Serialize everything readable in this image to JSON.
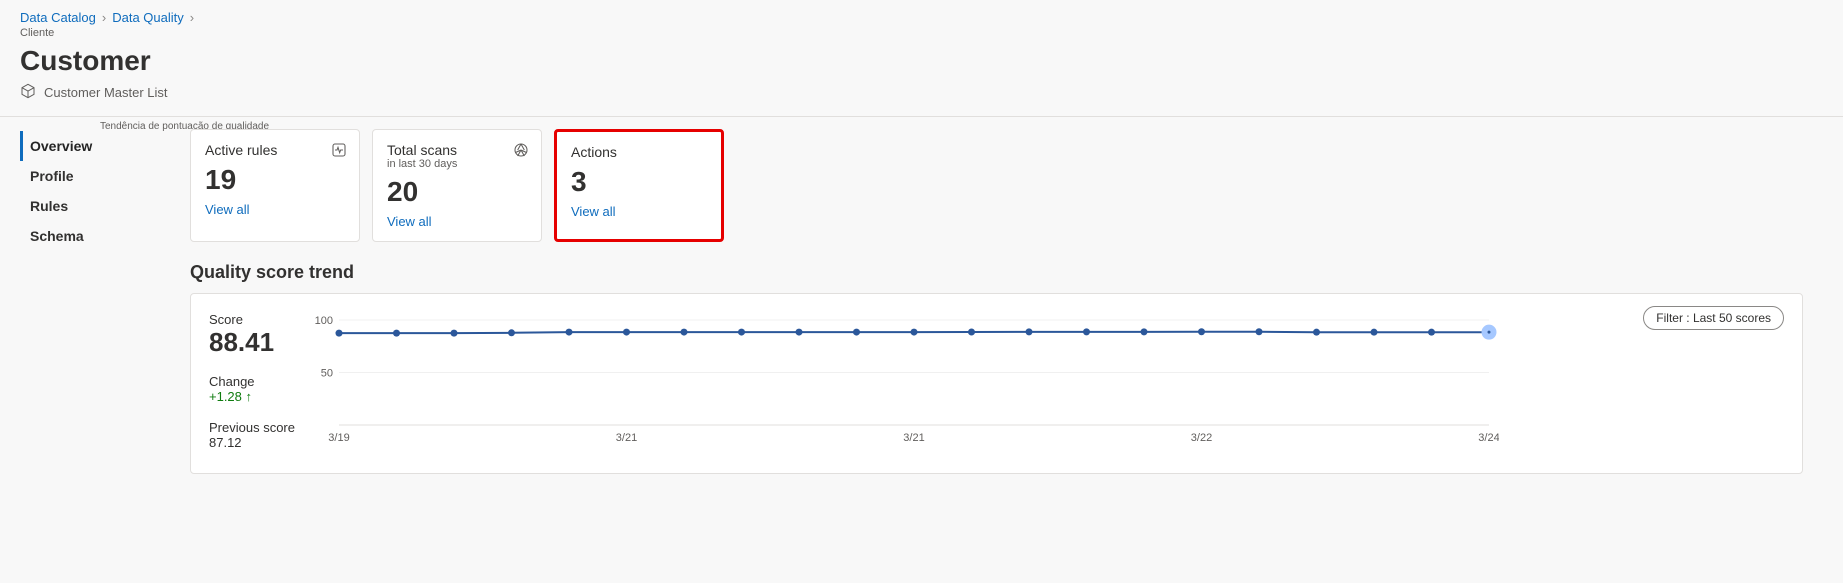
{
  "breadcrumbs": {
    "items": [
      "Data Catalog",
      "Data Quality"
    ],
    "sub": "Cliente"
  },
  "page_title": "Customer",
  "subtitle": "Customer Master List",
  "annotation": "Tendência de pontuação de qualidade",
  "sidebar": {
    "items": [
      {
        "label": "Overview",
        "selected": true
      },
      {
        "label": "Profile",
        "selected": false
      },
      {
        "label": "Rules",
        "selected": false
      },
      {
        "label": "Schema",
        "selected": false
      }
    ]
  },
  "cards": [
    {
      "title": "Active rules",
      "sub": "",
      "value": "19",
      "link": "View all",
      "icon": "heartbeat-icon",
      "highlight": false
    },
    {
      "title": "Total scans",
      "sub": "in last 30 days",
      "value": "20",
      "link": "View all",
      "icon": "aperture-icon",
      "highlight": false
    },
    {
      "title": "Actions",
      "sub": "",
      "value": "3",
      "link": "View all",
      "icon": "",
      "highlight": true
    }
  ],
  "section_title": "Quality score trend",
  "filter_label": "Filter : Last 50 scores",
  "score_panel": {
    "score_label": "Score",
    "score": "88.41",
    "change_label": "Change",
    "change": "+1.28 ↑",
    "prev_label": "Previous score",
    "prev": "87.12"
  },
  "chart_data": {
    "type": "line",
    "ylim": [
      0,
      100
    ],
    "yticks": [
      100,
      50
    ],
    "xticks": [
      "3/19",
      "3/21",
      "3/21",
      "3/22",
      "3/24"
    ],
    "values": [
      87.5,
      87.5,
      87.5,
      87.8,
      88.5,
      88.5,
      88.5,
      88.5,
      88.5,
      88.5,
      88.5,
      88.6,
      88.7,
      88.7,
      88.7,
      88.8,
      88.8,
      88.4,
      88.4,
      88.4,
      88.41
    ],
    "title": "Quality score trend",
    "xlabel": "",
    "ylabel": ""
  }
}
